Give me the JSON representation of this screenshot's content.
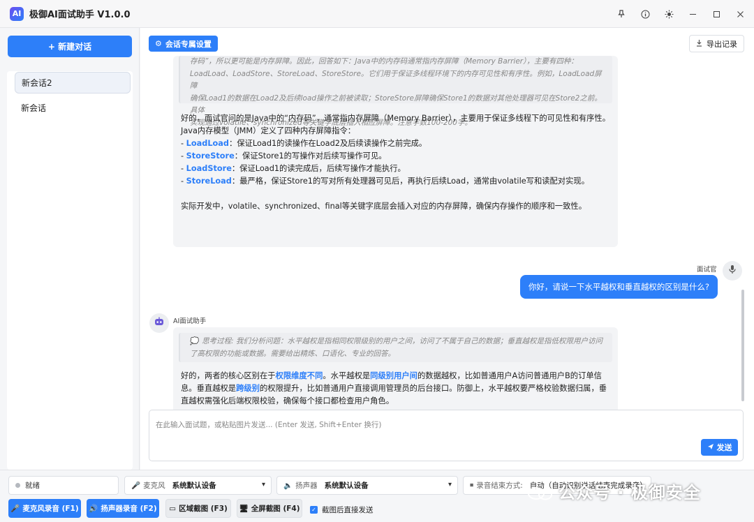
{
  "app": {
    "title": "极御AI面试助手 V1.0.0",
    "logo_text": "AI"
  },
  "sidebar": {
    "new_chat_label": "+ 新建对话",
    "sessions": [
      {
        "label": "新会话2",
        "active": true
      },
      {
        "label": "新会话",
        "active": false
      }
    ]
  },
  "toolbar": {
    "settings_label": "会话专属设置",
    "export_label": "导出记录"
  },
  "messages": {
    "first": {
      "think_lines": [
        "存码”，所以更可能是内存屏障。因此，回答如下：Java中的内存码通常指内存屏障（Memory Barrier），主要有四种：",
        "LoadLoad、LoadStore、StoreLoad、StoreStore。它们用于保证多线程环境下的内存可见性和有序性。例如，LoadLoad屏障",
        "确保Load1的数据在Load2及后续load操作之前被读取；StoreStore屏障确保Store1的数据对其他处理器可见在Store2之前。具体",
        "实现通过volatile、synchronized等关键字底层插入相应屏障。注意字数100-200字。"
      ],
      "intro": "好的，面试官问的是Java中的“内存码”，通常指内存屏障（Memory Barrier），主要用于保证多线程下的可见性和有序性。",
      "intro2": "Java内存模型（JMM）定义了四种内存屏障指令：",
      "items": [
        {
          "prefix": "- ",
          "kw": "LoadLoad",
          "text": "：保证Load1的读操作在Load2及后续读操作之前完成。"
        },
        {
          "prefix": "- ",
          "kw": "StoreStore",
          "text": "：保证Store1的写操作对后续写操作可见。"
        },
        {
          "prefix": "- ",
          "kw": "LoadStore",
          "text": "：保证Load1的读完成后，后续写操作才能执行。"
        },
        {
          "prefix": "- ",
          "kw": "StoreLoad",
          "text": "：最严格，保证Store1的写对所有处理器可见后，再执行后续Load，通常由volatile写和读配对实现。"
        }
      ],
      "outro": "实际开发中，volatile、synchronized、final等关键字底层会插入对应的内存屏障，确保内存操作的顺序和一致性。"
    },
    "user": {
      "role": "面试官",
      "text": "你好，请说一下水平越权和垂直越权的区别是什么?"
    },
    "second": {
      "role": "AI面试助手",
      "think_lines": [
        "思考过程: 我们分析问题：水平越权是指相同权限级别的用户之间，访问了不属于自己的数据；垂直越权是指低权限用户访问",
        "了高权限的功能或数据。需要给出精炼、口语化、专业的回答。"
      ],
      "p1a": "好的，两者的核心区别在于",
      "kw1": "权限维度不同",
      "p1b": "。水平越权是",
      "kw2": "同级别用户间",
      "p1c": "的数据越权，比如普通用户A访问普通用户B的订单信",
      "p2a": "息。垂直越权是",
      "kw3": "跨级别",
      "p2b": "的权限提升，比如普通用户直接调用管理员的后台接口。防御上，水平越权要严格校验数据归属，垂",
      "p3": "直越权需强化后端权限校验，确保每个接口都检查用户角色。"
    }
  },
  "input": {
    "placeholder": "在此输入面试题，或粘贴图片发送... (Enter 发送, Shift+Enter 换行)",
    "send_label": "发送"
  },
  "bottom": {
    "status": "就绪",
    "mic_label": "麦克风",
    "mic_value": "系统默认设备",
    "speaker_label": "扬声器",
    "speaker_value": "系统默认设备",
    "end_label": "录音结束方式:",
    "end_value": "自动（自动识别说话结束完成录音）",
    "btn_mic_record": "麦克风录音 (F1)",
    "btn_speaker_record": "扬声器录音 (F2)",
    "btn_region": "区域截图 (F3)",
    "btn_fullscreen": "全屏截图 (F4)",
    "checkbox_label": "截图后直接发送"
  },
  "watermark": {
    "text": "公众号 · 极御安全"
  },
  "colors": {
    "accent": "#2d7ff9",
    "keyword": "#2d7ff9"
  }
}
